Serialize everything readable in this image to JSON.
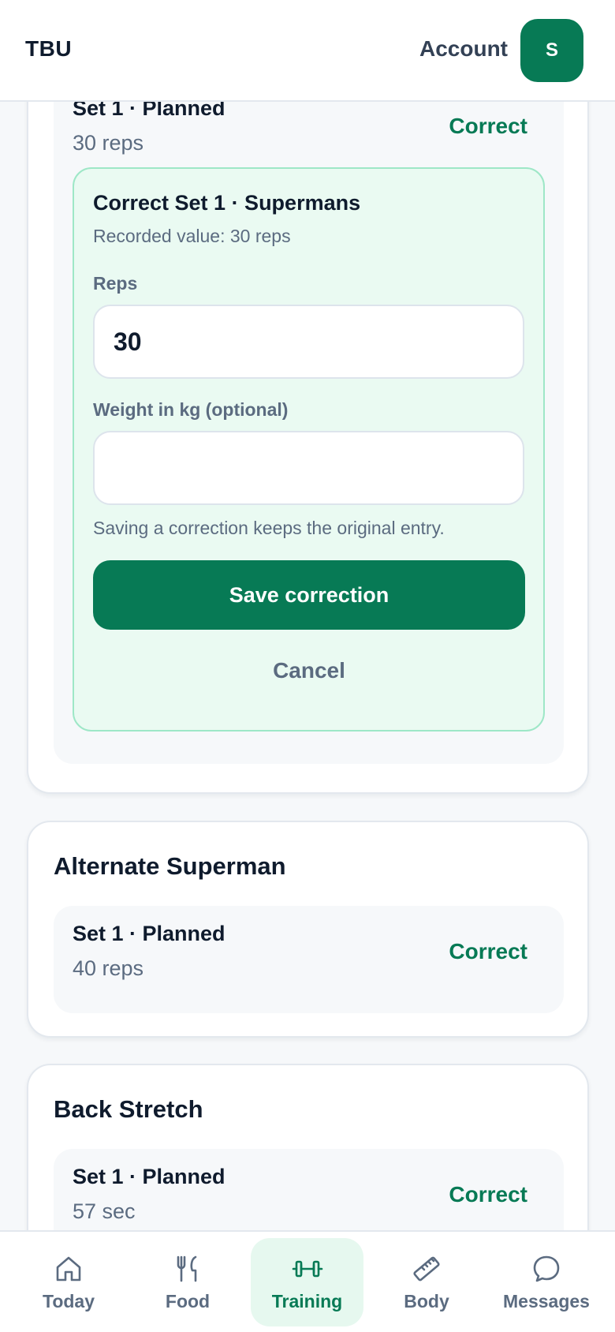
{
  "header": {
    "brand": "TBU",
    "account_label": "Account",
    "avatar_initial": "S"
  },
  "exercises": [
    {
      "name": "Supermans",
      "sets": [
        {
          "title": "Set 1 · Planned",
          "value": "30 reps",
          "action": "Correct"
        }
      ],
      "correction": {
        "title": "Correct Set 1 · Supermans",
        "recorded": "Recorded value: 30 reps",
        "reps_label": "Reps",
        "reps_value": "30",
        "weight_label": "Weight in kg (optional)",
        "weight_value": "",
        "hint": "Saving a correction keeps the original entry.",
        "save_label": "Save correction",
        "cancel_label": "Cancel"
      }
    },
    {
      "name": "Alternate Superman",
      "sets": [
        {
          "title": "Set 1 · Planned",
          "value": "40 reps",
          "action": "Correct"
        }
      ]
    },
    {
      "name": "Back Stretch",
      "sets": [
        {
          "title": "Set 1 · Planned",
          "value": "57 sec",
          "action": "Correct"
        }
      ]
    }
  ],
  "nav": {
    "active": "Training",
    "items": [
      {
        "label": "Today",
        "icon": "home-icon"
      },
      {
        "label": "Food",
        "icon": "fork-knife-icon"
      },
      {
        "label": "Training",
        "icon": "dumbbell-icon"
      },
      {
        "label": "Body",
        "icon": "ruler-icon"
      },
      {
        "label": "Messages",
        "icon": "chat-bubble-icon"
      }
    ]
  },
  "colors": {
    "accent": "#077a55",
    "panel_bg": "#eafaf2",
    "panel_border": "#9ee7c7",
    "muted_text": "#5b6b80"
  }
}
